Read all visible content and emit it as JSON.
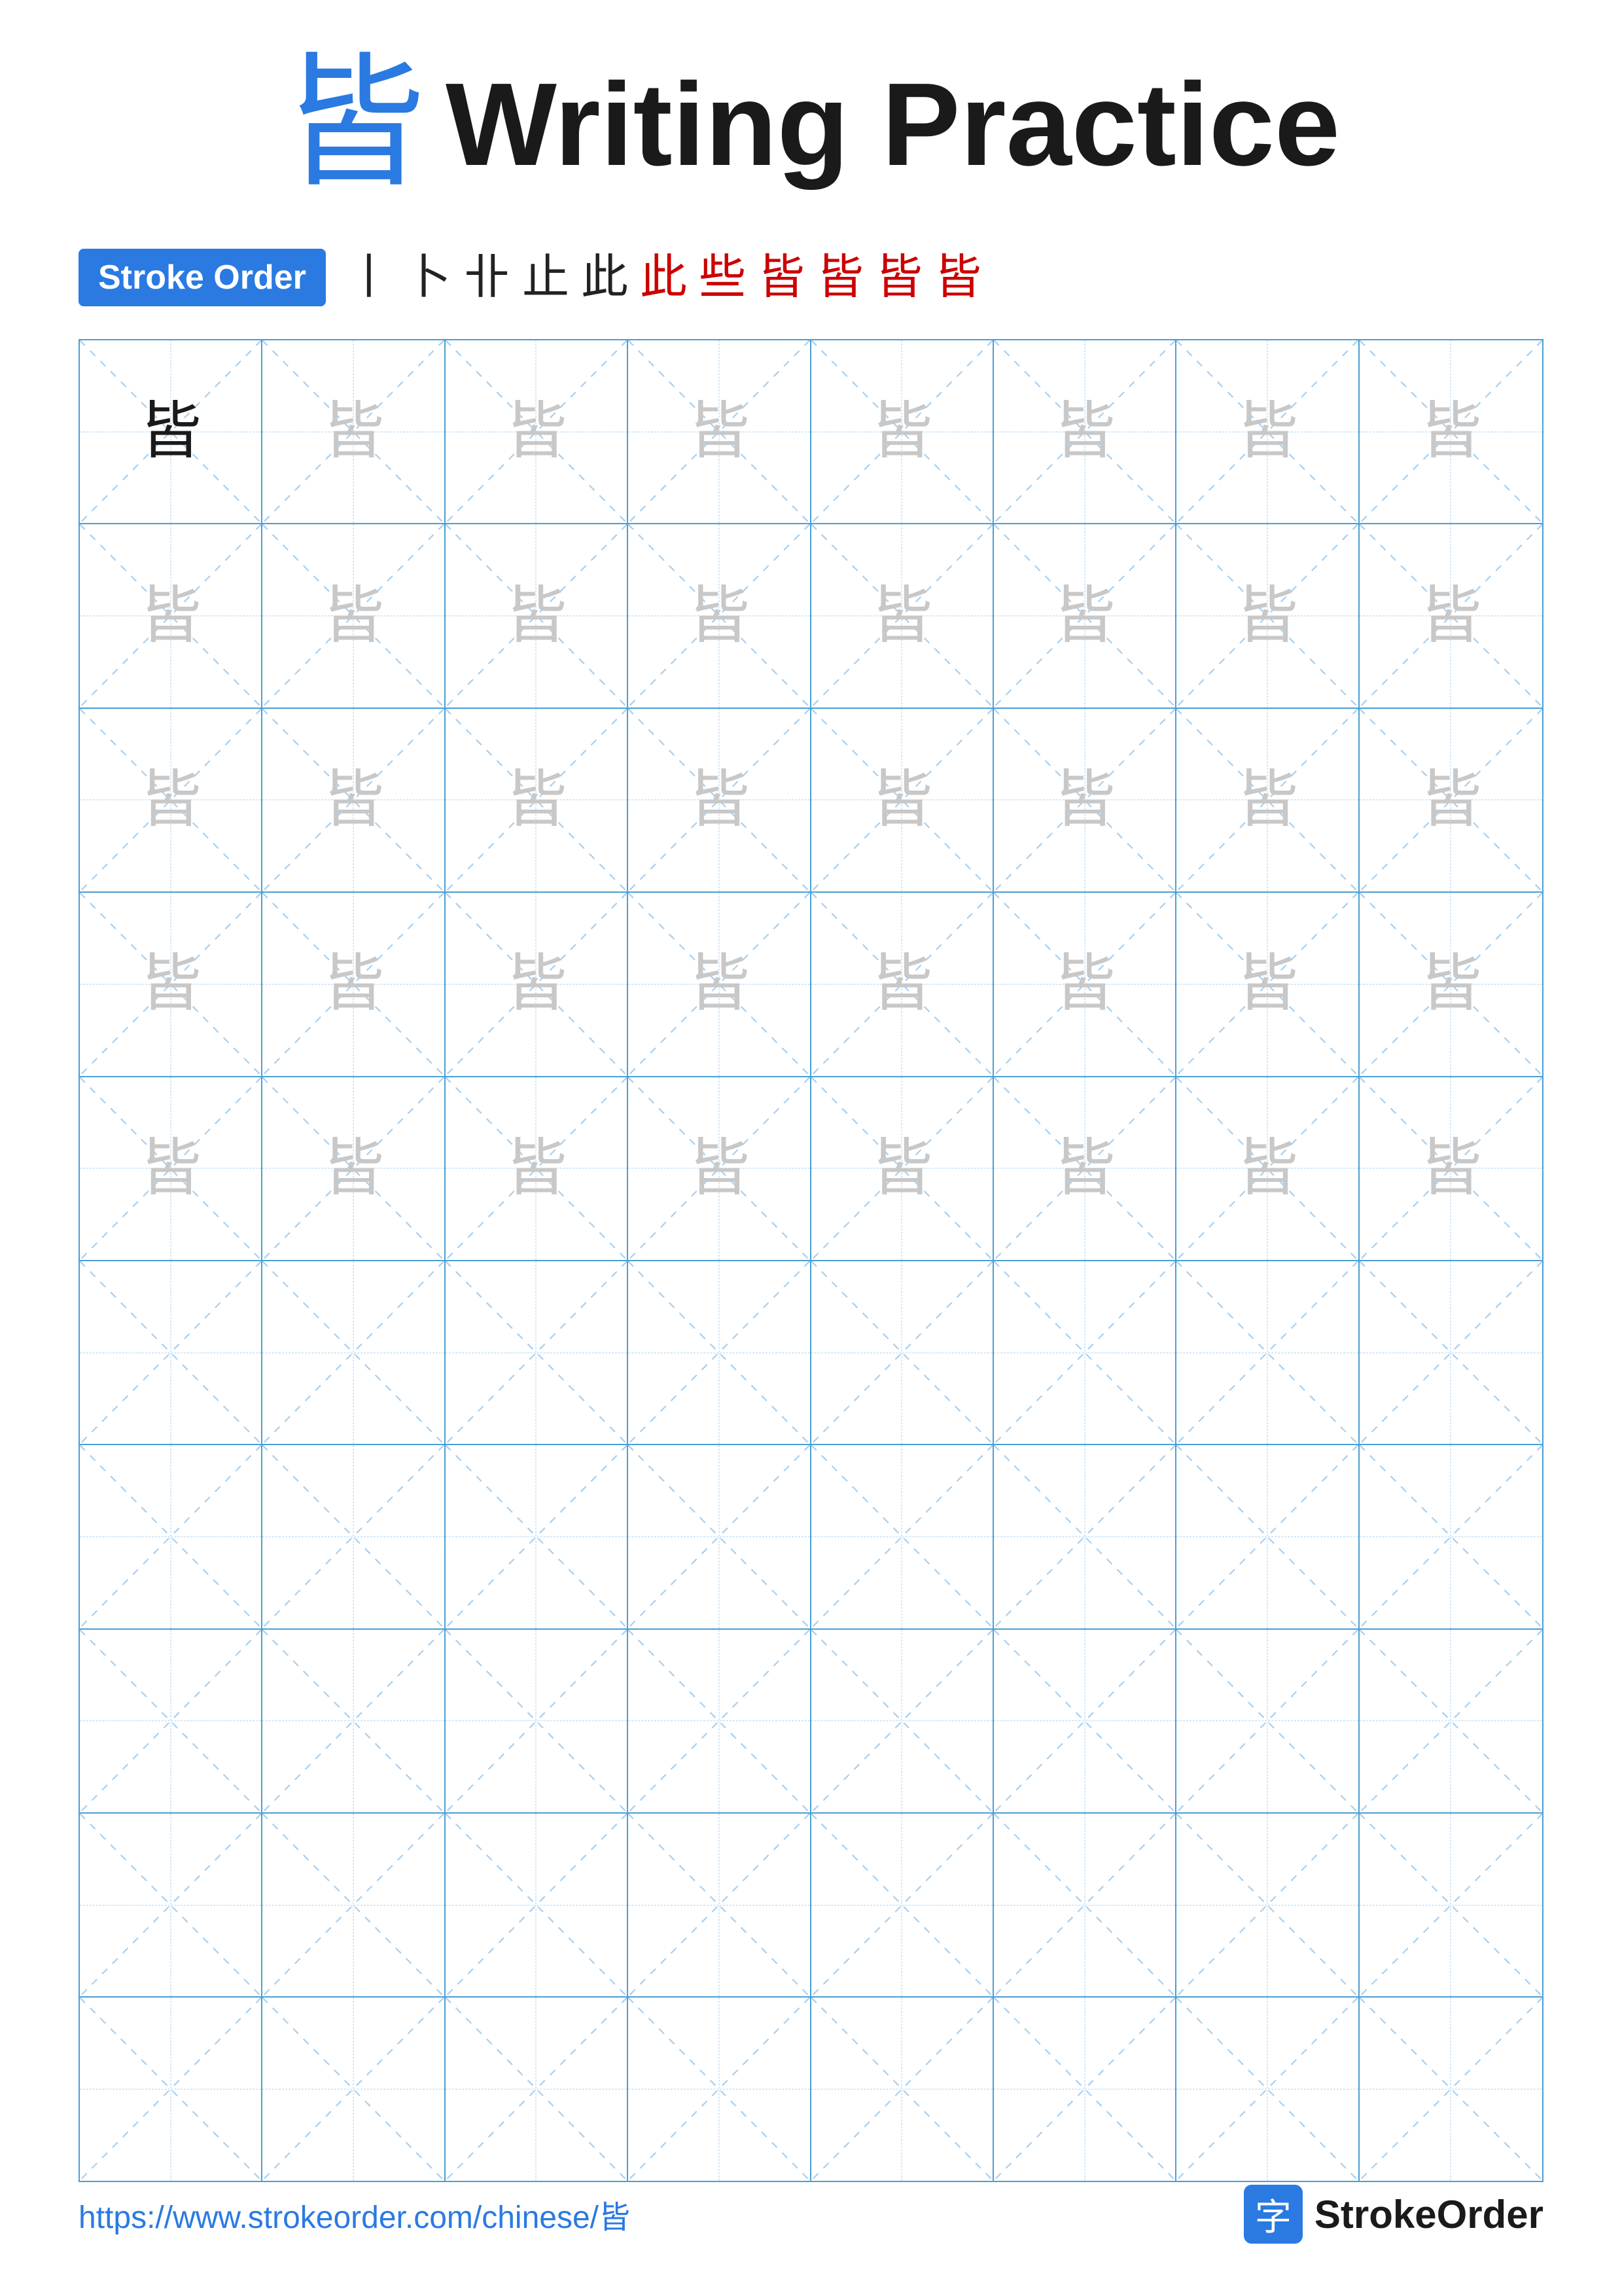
{
  "title": {
    "char": "皆",
    "text": "Writing Practice"
  },
  "stroke_order": {
    "badge_label": "Stroke Order",
    "steps": [
      "丨",
      "卜",
      "卝",
      "止",
      "此",
      "此",
      "些",
      "𠦶",
      "皆",
      "皆",
      "皆"
    ]
  },
  "grid": {
    "rows": 10,
    "cols": 8,
    "practice_char": "皆",
    "guide_char": "皆",
    "filled_rows": 5,
    "empty_rows": 5
  },
  "footer": {
    "url": "https://www.strokeorder.com/chinese/皆",
    "brand": "StrokeOrder",
    "brand_char": "字"
  }
}
